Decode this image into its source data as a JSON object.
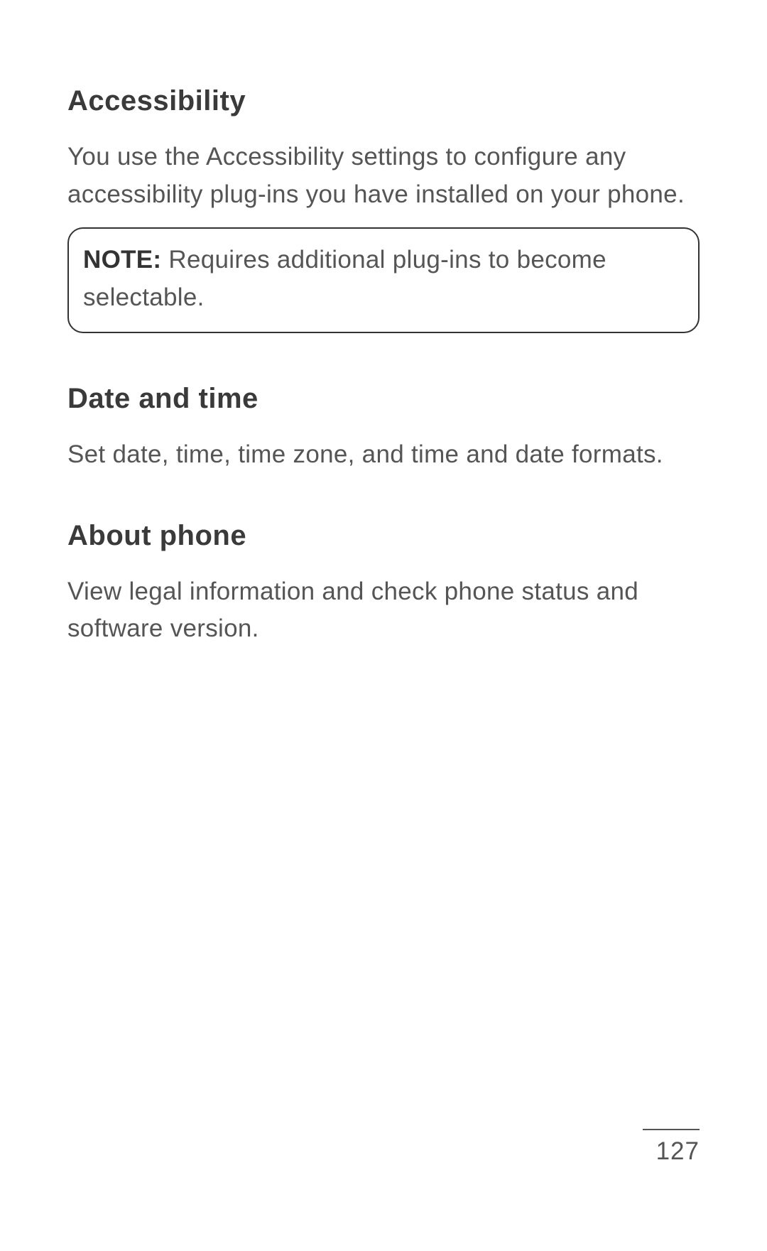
{
  "sections": {
    "accessibility": {
      "heading": "Accessibility",
      "body": "You use the Accessibility settings to configure any accessibility plug-ins you have installed on your phone.",
      "note_label": "NOTE:",
      "note_text": " Requires additional plug-ins to become selectable."
    },
    "datetime": {
      "heading": "Date and time",
      "body": "Set date, time, time zone, and time and date formats."
    },
    "about": {
      "heading": "About phone",
      "body": "View legal information and check phone status and software version."
    }
  },
  "page_number": "127"
}
